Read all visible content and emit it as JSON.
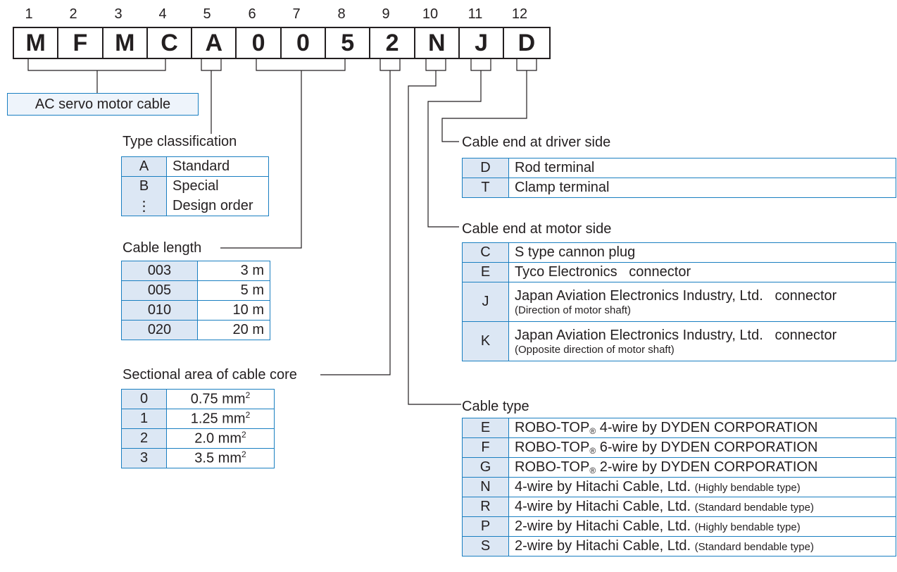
{
  "positions": [
    "1",
    "2",
    "3",
    "4",
    "5",
    "6",
    "7",
    "8",
    "9",
    "10",
    "11",
    "12"
  ],
  "code": [
    "M",
    "F",
    "M",
    "C",
    "A",
    "0",
    "0",
    "5",
    "2",
    "N",
    "J",
    "D"
  ],
  "ac_servo": "AC servo motor cable",
  "type_classification": {
    "title": "Type classification",
    "rows": [
      {
        "code": "A",
        "desc": "Standard"
      },
      {
        "code": "B",
        "desc": "Special"
      },
      {
        "code": "⋮",
        "desc": "Design order"
      }
    ]
  },
  "cable_length": {
    "title": "Cable length",
    "rows": [
      {
        "code": "003",
        "desc": "3 m"
      },
      {
        "code": "005",
        "desc": "5 m"
      },
      {
        "code": "010",
        "desc": "10 m"
      },
      {
        "code": "020",
        "desc": "20 m"
      }
    ]
  },
  "sectional_area": {
    "title": "Sectional area of cable core",
    "unit": "mm",
    "sup": "2",
    "rows": [
      {
        "code": "0",
        "value": "0.75"
      },
      {
        "code": "1",
        "value": "1.25"
      },
      {
        "code": "2",
        "value": "2.0"
      },
      {
        "code": "3",
        "value": "3.5"
      }
    ]
  },
  "driver_side": {
    "title": "Cable end at driver side",
    "rows": [
      {
        "code": "D",
        "desc": "Rod terminal"
      },
      {
        "code": "T",
        "desc": "Clamp terminal"
      }
    ]
  },
  "motor_side": {
    "title": "Cable end at motor side",
    "rows": [
      {
        "code": "C",
        "desc": "S type cannon plug",
        "note": ""
      },
      {
        "code": "E",
        "desc": "Tyco Electronics   connector",
        "note": ""
      },
      {
        "code": "J",
        "desc": "Japan Aviation Electronics Industry, Ltd.   connector",
        "note": "(Direction of motor shaft)"
      },
      {
        "code": "K",
        "desc": "Japan Aviation Electronics Industry, Ltd.   connector",
        "note": "(Opposite direction of motor shaft)"
      }
    ]
  },
  "cable_type": {
    "title": "Cable type",
    "reg": "®",
    "rows": [
      {
        "code": "E",
        "brand": "ROBO-TOP",
        "desc": " 4-wire by DYDEN CORPORATION",
        "note": ""
      },
      {
        "code": "F",
        "brand": "ROBO-TOP",
        "desc": " 6-wire by DYDEN CORPORATION",
        "note": ""
      },
      {
        "code": "G",
        "brand": "ROBO-TOP",
        "desc": " 2-wire by DYDEN CORPORATION",
        "note": ""
      },
      {
        "code": "N",
        "brand": "",
        "desc": "4-wire by Hitachi Cable, Ltd. ",
        "note": "(Highly bendable type)"
      },
      {
        "code": "R",
        "brand": "",
        "desc": "4-wire by Hitachi Cable, Ltd. ",
        "note": "(Standard bendable type)"
      },
      {
        "code": "P",
        "brand": "",
        "desc": "2-wire by Hitachi Cable, Ltd. ",
        "note": "(Highly bendable type)"
      },
      {
        "code": "S",
        "brand": "",
        "desc": "2-wire by Hitachi Cable, Ltd. ",
        "note": "(Standard bendable type)"
      }
    ]
  }
}
